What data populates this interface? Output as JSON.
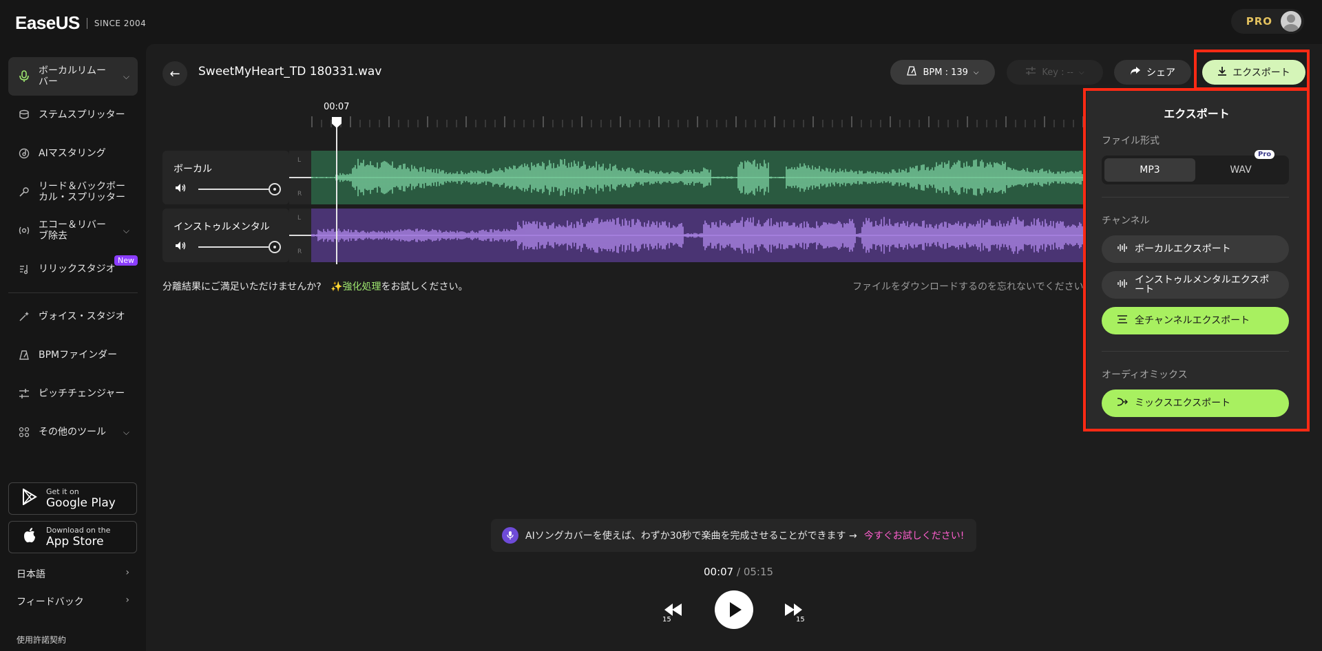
{
  "app": {
    "brand": "EaseUS",
    "since": "SINCE 2004",
    "pro_label": "PRO"
  },
  "sidebar": {
    "items": [
      {
        "label": "ボーカルリムーバー",
        "icon": "microphone-icon",
        "active": true,
        "has_chevron": true
      },
      {
        "label": "ステムスプリッター",
        "icon": "stack-icon"
      },
      {
        "label": "AIマスタリング",
        "icon": "disc-icon"
      },
      {
        "label": "リード＆バックボーカル・スプリッター",
        "icon": "mic-split-icon"
      },
      {
        "label": "エコー＆リバーブ除去",
        "icon": "echo-icon",
        "has_chevron": true
      },
      {
        "label": "リリックスタジオ",
        "icon": "lyrics-icon",
        "badge": "New"
      },
      {
        "label": "ヴォイス・スタジオ",
        "icon": "sparkle-icon"
      },
      {
        "label": "BPMファインダー",
        "icon": "metronome-icon"
      },
      {
        "label": "ピッチチェンジャー",
        "icon": "sliders-icon"
      },
      {
        "label": "その他のツール",
        "icon": "grid-icon",
        "has_chevron": true
      }
    ],
    "google_play": {
      "small": "Get it on",
      "big": "Google Play"
    },
    "app_store": {
      "small": "Download on the",
      "big": "App Store"
    },
    "language": "日本語",
    "feedback": "フィードバック",
    "terms": "使用許諾契約"
  },
  "header": {
    "file_name": "SweetMyHeart_TD 180331.wav",
    "bpm_label": "BPM : 139",
    "key_label": "Key : --",
    "share_label": "シェア",
    "export_label": "エクスポート"
  },
  "timeline": {
    "current_marker": "00:07"
  },
  "tracks": [
    {
      "name": "ボーカル",
      "color": "#7fd6a4",
      "bg": "#2a5a40"
    },
    {
      "name": "インストゥルメンタル",
      "color": "#b48cf0",
      "bg": "#4a3473"
    }
  ],
  "channel_labels": {
    "left": "L",
    "right": "R"
  },
  "hint": {
    "prefix": "分離結果にご満足いただけませんか?",
    "highlight": "✨強化処理",
    "suffix": "をお試しください。",
    "right": "ファイルをダウンロードするのを忘れないでください"
  },
  "promo": {
    "text": "AIソングカバーを使えば、わずか30秒で楽曲を完成させることができます →",
    "link": "今すぐお試しください!"
  },
  "player": {
    "current": "00:07",
    "separator": " / ",
    "total": "05:15",
    "skip_back": "15",
    "skip_forward": "15"
  },
  "export_panel": {
    "title": "エクスポート",
    "format_label": "ファイル形式",
    "formats": [
      "MP3",
      "WAV"
    ],
    "selected_format": "MP3",
    "pro_chip": "Pro",
    "channel_label": "チャンネル",
    "vocal_export": "ボーカルエクスポート",
    "instrumental_export": "インストゥルメンタルエクスポート",
    "all_export": "全チャンネルエクスポート",
    "mix_label": "オーディオミックス",
    "mix_export": "ミックスエクスポート"
  },
  "colors": {
    "accent_green": "#a8f060",
    "highlight_red": "#ff2a14",
    "link_pink": "#ff5fcf"
  }
}
